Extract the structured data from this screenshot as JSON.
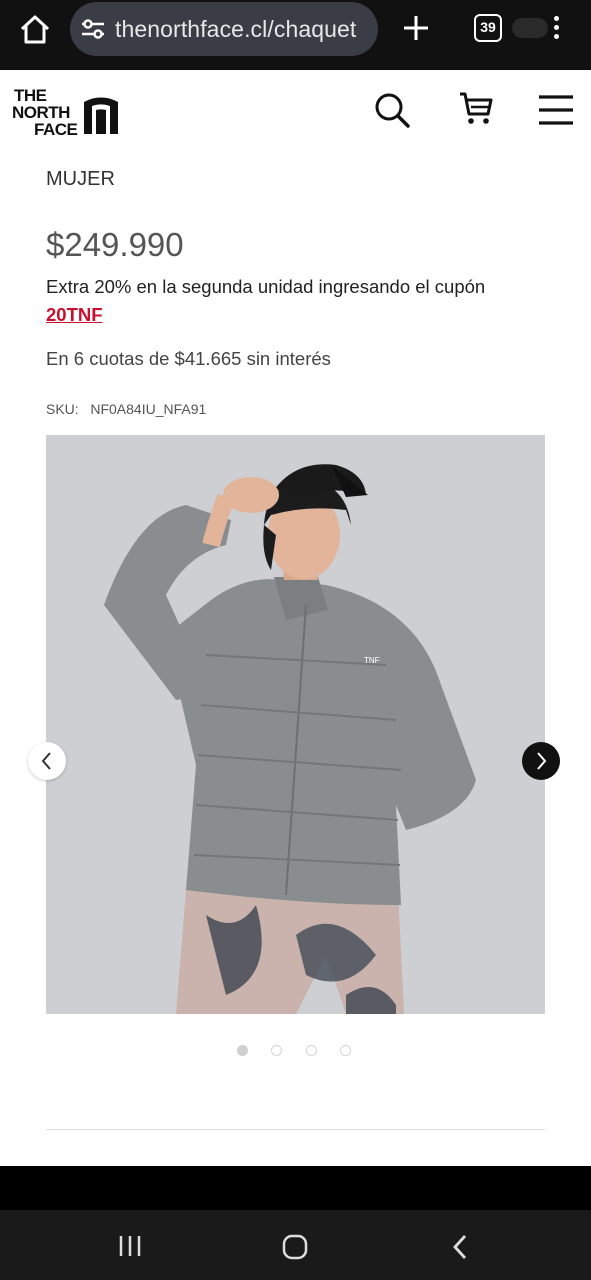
{
  "browser": {
    "url": "thenorthface.cl/chaquet",
    "tab_count": "39"
  },
  "header": {
    "logo_text": "THE NORTH FACE"
  },
  "product": {
    "category": "MUJER",
    "price": "$249.990",
    "promo_text": "Extra 20% en la segunda unidad ingresando el cupón",
    "coupon_code": "20TNF",
    "installments": "En 6 cuotas de $41.665 sin interés",
    "sku": "SKU:   NF0A84IU_NFA91"
  },
  "gallery": {
    "image_index": 1,
    "image_count": 4
  },
  "colors": {
    "coupon": "#c8102e",
    "jacket": "#8a8d90",
    "background": "#cdcfd2"
  },
  "icons": [
    "home-icon",
    "tune-icon",
    "plus-icon",
    "search-icon",
    "cart-icon",
    "menu-icon",
    "chevron-left-icon",
    "chevron-right-icon",
    "recents-icon",
    "home-circle-icon",
    "back-icon"
  ]
}
